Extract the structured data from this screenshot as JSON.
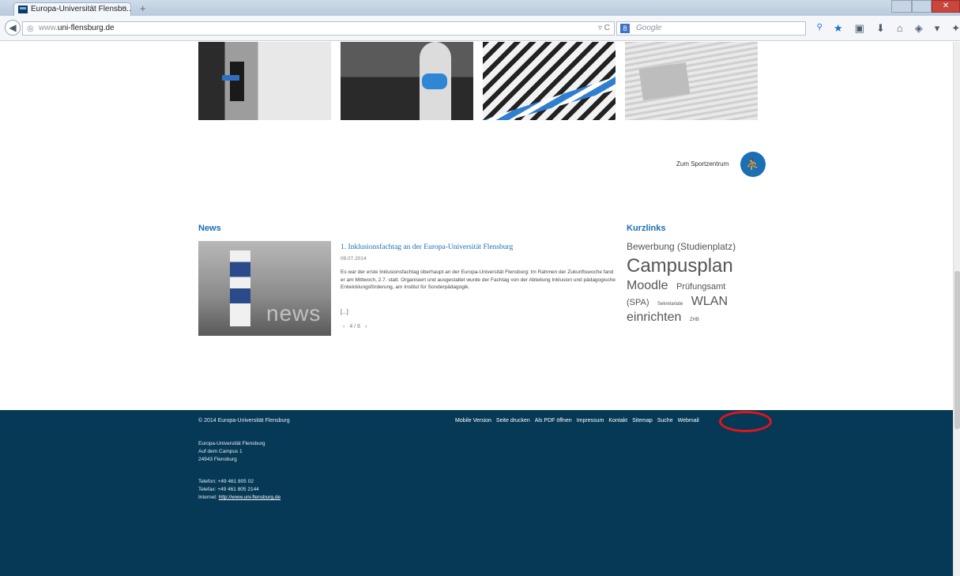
{
  "browser": {
    "tab_title": "Europa-Universität Flensbu...",
    "tab_close": "×",
    "new_tab": "+",
    "url_prefix": "www.",
    "url_host": "uni-flensburg.de",
    "search_engine": "Google",
    "search_placeholder": "Google"
  },
  "sport": {
    "label": "Zum Sportzentrum"
  },
  "news": {
    "heading": "News",
    "image_watermark": "news",
    "article_title": "1. Inklusionsfachtag an der Europa-Universität Flensburg",
    "article_date": "09.07.2014",
    "article_text": "Es war der erste Inklusionsfachtag überhaupt an der Europa-Universität Flensburg: Im Rahmen der Zukunftswoche fand er am Mittwoch, 2.7. statt. Organisiert und ausgestaltet wurde der Fachtag von der Abteilung Inklusion und pädagogische Entwicklungsförderung, am Institut für Sonderpädagogik.",
    "more": "[...]",
    "pager_prev": "‹",
    "pager_label": "4 / 6",
    "pager_next": "›"
  },
  "kurzlinks": {
    "heading": "Kurzlinks",
    "bewerbung": "Bewerbung (Studienplatz)",
    "campusplan": "Campusplan",
    "moodle": "Moodle",
    "pruefungsamt": "Prüfungsamt",
    "spa": "(SPA)",
    "sekretariate": "Sekretariate",
    "wlan": "WLAN",
    "einrichten": "einrichten",
    "zhb": "ZHB"
  },
  "footer": {
    "copyright": "© 2014 Europa-Universität Flensburg",
    "links": {
      "mobile": "Mobile Version",
      "print": "Seite drucken",
      "pdf": "Als PDF öffnen",
      "impressum": "Impressum",
      "kontakt": "Kontakt",
      "sitemap": "Sitemap",
      "suche": "Suche",
      "webmail": "Webmail"
    },
    "address_line1": "Europa-Universität Flensburg",
    "address_line2": "Auf dem Campus 1",
    "address_line3": "24943 Flensburg",
    "telefon": "Telefon: +49 461 805 02",
    "telefax": "Telefax: +49 461 805 2144",
    "internet_label": "Internet:",
    "internet_url": "http://www.uni-flensburg.de"
  },
  "colors": {
    "accent_blue": "#1a6fb5",
    "footer_bg": "#053956",
    "highlight_red": "#e3141b"
  }
}
